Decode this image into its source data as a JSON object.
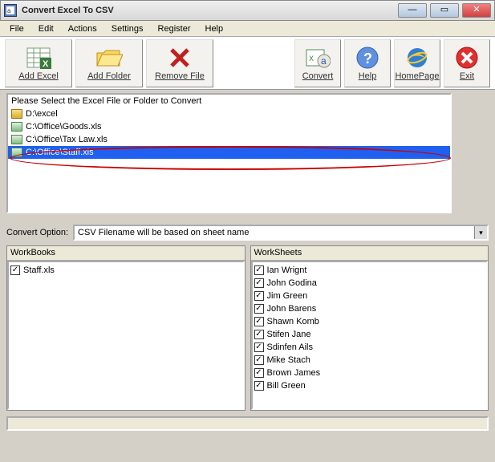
{
  "window": {
    "title": "Convert Excel To CSV"
  },
  "menu": {
    "file": "File",
    "edit": "Edit",
    "actions": "Actions",
    "settings": "Settings",
    "register": "Register",
    "help": "Help"
  },
  "toolbar": {
    "addExcel": "Add Excel",
    "addFolder": "Add Folder",
    "removeFile": "Remove File",
    "convert": "Convert",
    "help": "Help",
    "homepage": "HomePage",
    "exit": "Exit"
  },
  "filelist": {
    "header": "Please Select the Excel File or Folder to Convert",
    "items": [
      {
        "type": "folder",
        "path": "D:\\excel",
        "selected": false
      },
      {
        "type": "file",
        "path": "C:\\Office\\Goods.xls",
        "selected": false
      },
      {
        "type": "file",
        "path": "C:\\Office\\Tax Law.xls",
        "selected": false
      },
      {
        "type": "file",
        "path": "C:\\Office\\Staff.xls",
        "selected": true
      }
    ]
  },
  "option": {
    "label": "Convert Option:",
    "value": "CSV Filename will be based on sheet name"
  },
  "workbooks": {
    "header": "WorkBooks",
    "items": [
      {
        "name": "Staff.xls",
        "checked": true
      }
    ]
  },
  "worksheets": {
    "header": "WorkSheets",
    "items": [
      {
        "name": "Ian Wrignt",
        "checked": true
      },
      {
        "name": "John Godina",
        "checked": true
      },
      {
        "name": "Jim Green",
        "checked": true
      },
      {
        "name": "John Barens",
        "checked": true
      },
      {
        "name": "Shawn Komb",
        "checked": true
      },
      {
        "name": "Stifen Jane",
        "checked": true
      },
      {
        "name": "Sdinfen Ails",
        "checked": true
      },
      {
        "name": "Mike Stach",
        "checked": true
      },
      {
        "name": "Brown James",
        "checked": true
      },
      {
        "name": "Bill Green",
        "checked": true
      }
    ]
  }
}
